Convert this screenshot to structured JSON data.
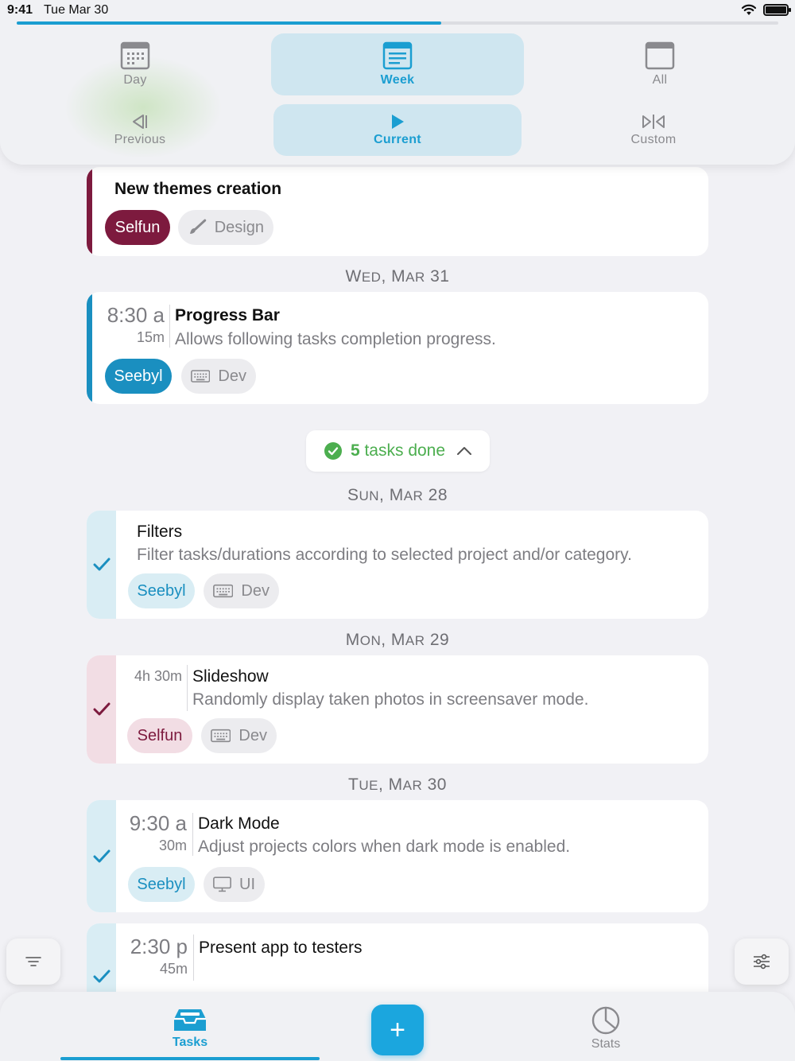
{
  "status": {
    "time": "9:41",
    "date": "Tue Mar 30"
  },
  "progress": {
    "fraction": 0.557
  },
  "period_picker": {
    "day": "Day",
    "week": "Week",
    "all": "All",
    "selected": "Week",
    "previous": "Previous",
    "current": "Current",
    "custom": "Custom",
    "selected_nav": "Current"
  },
  "colors": {
    "accent": "#1b9ed1",
    "selfun": "#7d1a3e",
    "seebyl": "#1a8fc0",
    "done_green": "#4cae4f"
  },
  "pending_tasks": [
    {
      "title": "New themes creation",
      "project": "Selfun",
      "category": "Design",
      "category_icon": "paintbrush-icon"
    },
    {
      "day_header": {
        "weekday": "Wed",
        "rest": ", Mar 31"
      },
      "time": "8:30 a",
      "duration": "15m",
      "title": "Progress Bar",
      "description": "Allows following tasks completion progress.",
      "project": "Seebyl",
      "category": "Dev",
      "category_icon": "keyboard-icon"
    }
  ],
  "done_summary": {
    "count": "5",
    "label": "tasks done"
  },
  "done_tasks": [
    {
      "day_header": {
        "weekday": "Sun",
        "rest": ", Mar 28"
      },
      "title": "Filters",
      "description": "Filter tasks/durations according to selected project and/or category.",
      "project": "Seebyl",
      "category": "Dev",
      "category_icon": "keyboard-icon"
    },
    {
      "day_header": {
        "weekday": "Mon",
        "rest": ", Mar 29"
      },
      "duration": "4h 30m",
      "title": "Slideshow",
      "description": "Randomly display taken photos in screensaver mode.",
      "project": "Selfun",
      "category": "Dev",
      "category_icon": "keyboard-icon"
    },
    {
      "day_header": {
        "weekday": "Tue",
        "rest": ", Mar 30"
      },
      "time": "9:30 a",
      "duration": "30m",
      "title": "Dark Mode",
      "description": "Adjust projects colors when dark mode is enabled.",
      "project": "Seebyl",
      "category": "UI",
      "category_icon": "monitor-icon"
    },
    {
      "time": "2:30 p",
      "duration": "45m",
      "title": "Present app to testers"
    }
  ],
  "tabbar": {
    "tasks": "Tasks",
    "stats": "Stats",
    "add": "+"
  }
}
